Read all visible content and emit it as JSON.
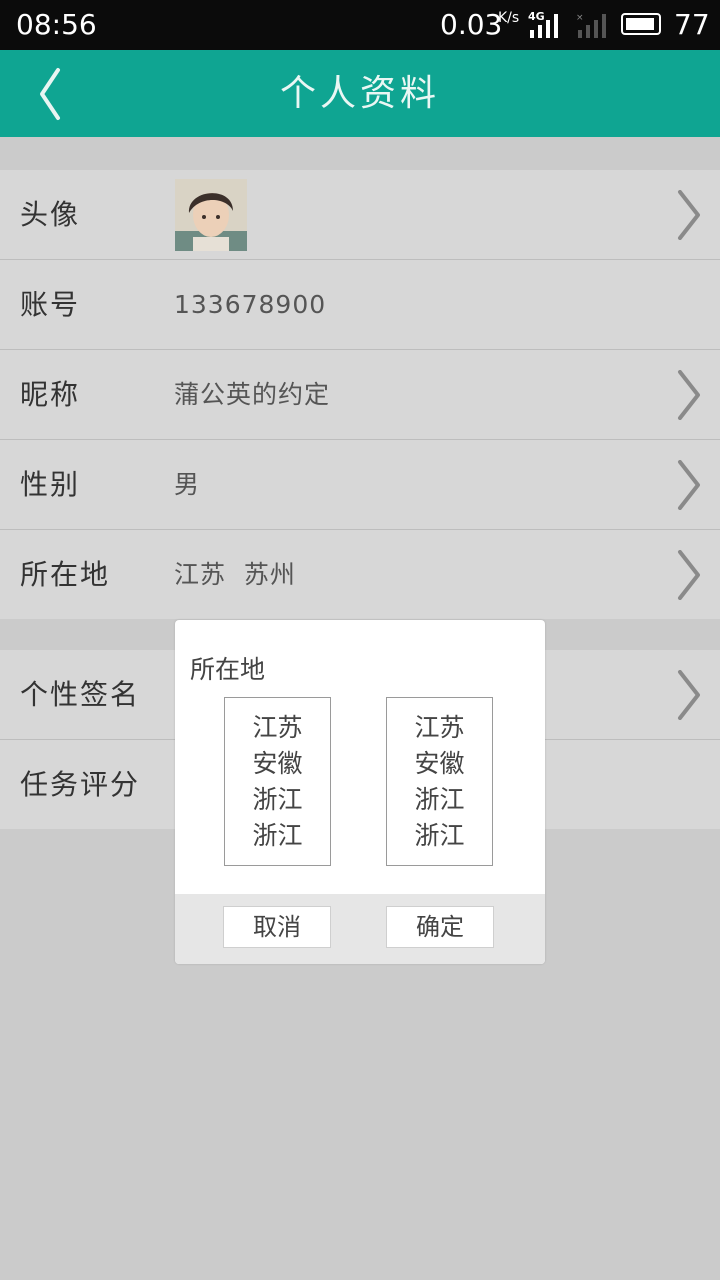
{
  "status_bar": {
    "time": "08:56",
    "speed": "0.03",
    "speed_unit": "K/s",
    "network": "4G",
    "battery": "77"
  },
  "header": {
    "title": "个人资料",
    "back_icon": "chevron-left-icon",
    "background": "#0fa592"
  },
  "profile": {
    "avatar_label": "头像",
    "account_label": "账号",
    "account_value": "133678900",
    "nickname_label": "昵称",
    "nickname_value": "蒲公英的约定",
    "gender_label": "性别",
    "gender_value": "男",
    "location_label": "所在地",
    "location_value": "江苏  苏州",
    "signature_label": "个性签名",
    "rating_label": "任务评分"
  },
  "location_dialog": {
    "title": "所在地",
    "province_options": [
      "江苏",
      "安徽",
      "浙江",
      "浙江"
    ],
    "city_options": [
      "江苏",
      "安徽",
      "浙江",
      "浙江"
    ],
    "cancel_label": "取消",
    "confirm_label": "确定"
  }
}
